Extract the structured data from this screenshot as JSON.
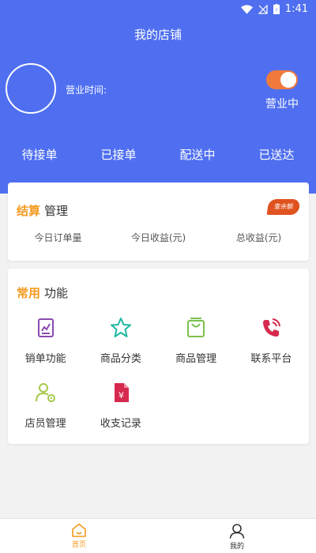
{
  "status_bar": {
    "time": "1:41"
  },
  "header": {
    "title": "我的店铺",
    "hours_label": "营业时间:",
    "status_label": "营业中",
    "status_on": true,
    "accent_color": "#f07a3c",
    "background_color": "#4f6ff0"
  },
  "order_tabs": [
    {
      "label": "待接单"
    },
    {
      "label": "已接单"
    },
    {
      "label": "配送中"
    },
    {
      "label": "已送达"
    }
  ],
  "settlement": {
    "title_accent": "结算",
    "title_rest": "管理",
    "badge": "查余额",
    "stats": [
      {
        "label": "今日订单量"
      },
      {
        "label": "今日收益(元)"
      },
      {
        "label": "总收益(元)"
      }
    ]
  },
  "functions": {
    "title_accent": "常用",
    "title_rest": "功能",
    "items": [
      {
        "label": "销单功能",
        "icon": "chart-document-icon",
        "color": "#8a4bb0"
      },
      {
        "label": "商品分类",
        "icon": "star-icon",
        "color": "#1fb8a3"
      },
      {
        "label": "商品管理",
        "icon": "shopping-bag-icon",
        "color": "#7cc04b"
      },
      {
        "label": "联系平台",
        "icon": "phone-icon",
        "color": "#d6294e"
      },
      {
        "label": "店员管理",
        "icon": "staff-gear-icon",
        "color": "#a6c94a"
      },
      {
        "label": "收支记录",
        "icon": "yuan-document-icon",
        "color": "#d6294e"
      }
    ]
  },
  "bottom_nav": {
    "items": [
      {
        "label": "首页",
        "icon": "home-icon",
        "active": true
      },
      {
        "label": "我的",
        "icon": "user-icon",
        "active": false
      }
    ]
  }
}
